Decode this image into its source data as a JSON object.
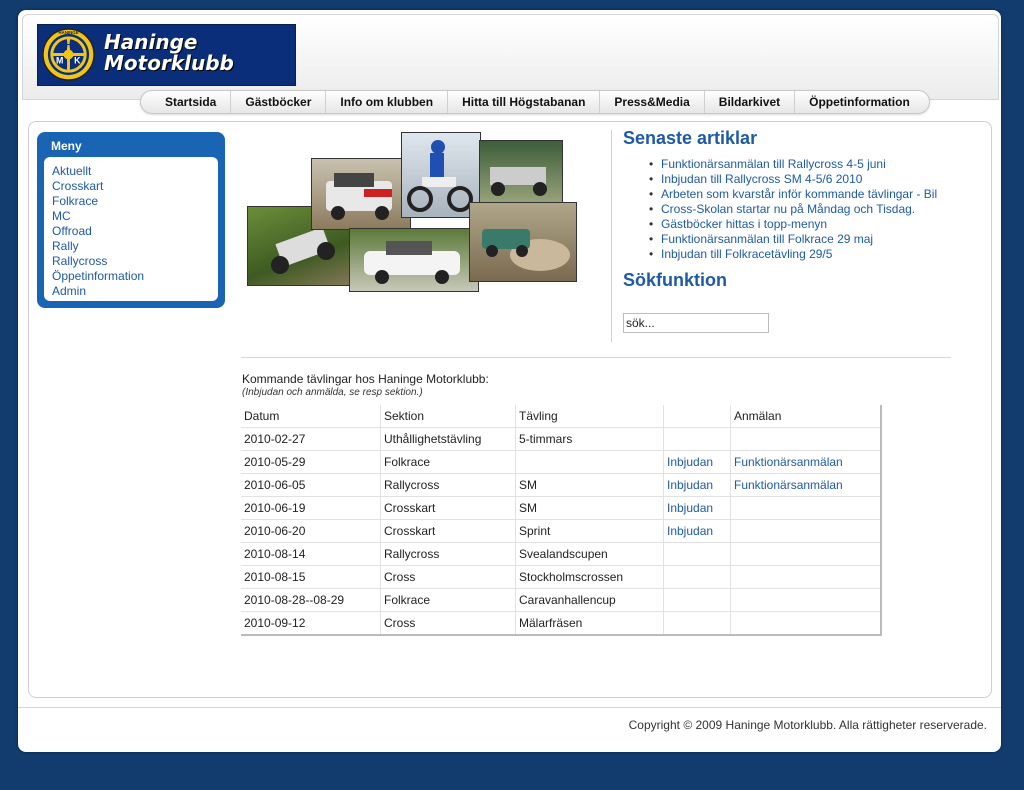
{
  "logo": {
    "line1": "Haninge",
    "line2": "Motorklubb",
    "emblem_letters": [
      "H",
      "M",
      "K"
    ],
    "emblem_small_text": "HANINGE"
  },
  "nav": [
    "Startsida",
    "Gästböcker",
    "Info om klubben",
    "Hitta till Högstabanan",
    "Press&Media",
    "Bildarkivet",
    "Öppetinformation"
  ],
  "menu": {
    "title": "Meny",
    "items": [
      "Aktuellt",
      "Crosskart",
      "Folkrace",
      "MC",
      "Offroad",
      "Rally",
      "Rallycross",
      "Öppetinformation",
      "Admin"
    ]
  },
  "latest": {
    "title": "Senaste artiklar",
    "items": [
      "Funktionärsanmälan till Rallycross 4-5 juni",
      "Inbjudan till Rallycross SM 4-5/6 2010",
      "Arbeten som kvarstår inför kommande tävlingar - Bil",
      "Cross-Skolan startar nu på Måndag och Tisdag.",
      "Gästböcker hittas i topp-menyn",
      "Funktionärsanmälan till Folkrace 29 maj",
      "Inbjudan till Folkracetävling 29/5"
    ]
  },
  "search": {
    "title": "Sökfunktion",
    "value": "sök..."
  },
  "competitions": {
    "intro": "Kommande tävlingar hos Haninge Motorklubb:",
    "note": "(Inbjudan och anmälda, se resp sektion.)",
    "headers": [
      "Datum",
      "Sektion",
      "Tävling",
      "",
      "Anmälan"
    ],
    "rows": [
      [
        "2010-02-27",
        "Uthållighetstävling",
        "5-timmars",
        "",
        ""
      ],
      [
        "2010-05-29",
        "Folkrace",
        "",
        "Inbjudan",
        "Funktionärsanmälan"
      ],
      [
        "2010-06-05",
        "Rallycross",
        "SM",
        "Inbjudan",
        "Funktionärsanmälan"
      ],
      [
        "2010-06-19",
        "Crosskart",
        "SM",
        "Inbjudan",
        ""
      ],
      [
        "2010-06-20",
        "Crosskart",
        "Sprint",
        "Inbjudan",
        ""
      ],
      [
        "2010-08-14",
        "Rallycross",
        "Svealandscupen",
        "",
        ""
      ],
      [
        "2010-08-15",
        "Cross",
        "Stockholmscrossen",
        "",
        ""
      ],
      [
        "2010-08-28--08-29",
        "Folkrace",
        "Caravanhallencup",
        "",
        ""
      ],
      [
        "2010-09-12",
        "Cross",
        "Mälarfräsen",
        "",
        ""
      ]
    ]
  },
  "footer": "Copyright © 2009 Haninge Motorklubb. Alla rättigheter reserverade.",
  "colors": {
    "background": "#123c6e",
    "accent": "#1a64b4",
    "link": "#1f5aa6",
    "logo_bg": "#0b2e7a",
    "emblem_yellow": "#f0c419"
  }
}
